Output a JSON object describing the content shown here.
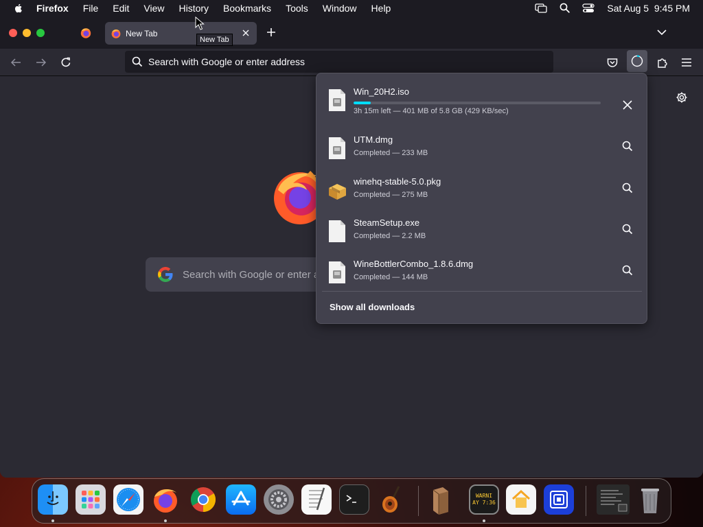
{
  "menubar": {
    "items": [
      "Firefox",
      "File",
      "Edit",
      "View",
      "History",
      "Bookmarks",
      "Tools",
      "Window",
      "Help"
    ],
    "datetime": "Sat Aug 5  9:45 PM"
  },
  "tabs": {
    "active_title": "New Tab",
    "tooltip": "New Tab"
  },
  "urlbar": {
    "placeholder": "Search with Google or enter address"
  },
  "newtab": {
    "search_placeholder": "Search with Google or enter address"
  },
  "downloads": {
    "items": [
      {
        "name": "Win_20H2.iso",
        "status": "3h 15m left — 401 MB of 5.8 GB (429 KB/sec)",
        "progress": 0.07,
        "icon": "disk-image-icon",
        "action": "cancel"
      },
      {
        "name": "UTM.dmg",
        "status": "Completed — 233 MB",
        "icon": "disk-image-icon",
        "action": "show-in-folder"
      },
      {
        "name": "winehq-stable-5.0.pkg",
        "status": "Completed — 275 MB",
        "icon": "package-icon",
        "action": "show-in-folder"
      },
      {
        "name": "SteamSetup.exe",
        "status": "Completed — 2.2 MB",
        "icon": "document-icon",
        "action": "show-in-folder"
      },
      {
        "name": "WineBottlerCombo_1.8.6.dmg",
        "status": "Completed — 144 MB",
        "icon": "disk-image-icon",
        "action": "show-in-folder"
      }
    ],
    "show_all_label": "Show all downloads"
  },
  "dock": {
    "apps": [
      "finder-icon",
      "launchpad-icon",
      "safari-icon",
      "firefox-icon",
      "chrome-icon",
      "app-store-icon",
      "system-preferences-icon",
      "textedit-icon",
      "terminal-icon",
      "garageband-icon",
      "wine-package-icon",
      "console-icon",
      "home-icon",
      "utm-icon",
      "downloads-stack-icon",
      "trash-icon"
    ],
    "console_text": "WARNI\nAY 7:36"
  },
  "colors": {
    "accent": "#00ddff",
    "panel_bg": "#42414d",
    "toolbar_bg": "#2b2a33",
    "tabstrip_bg": "#1c1b22"
  }
}
